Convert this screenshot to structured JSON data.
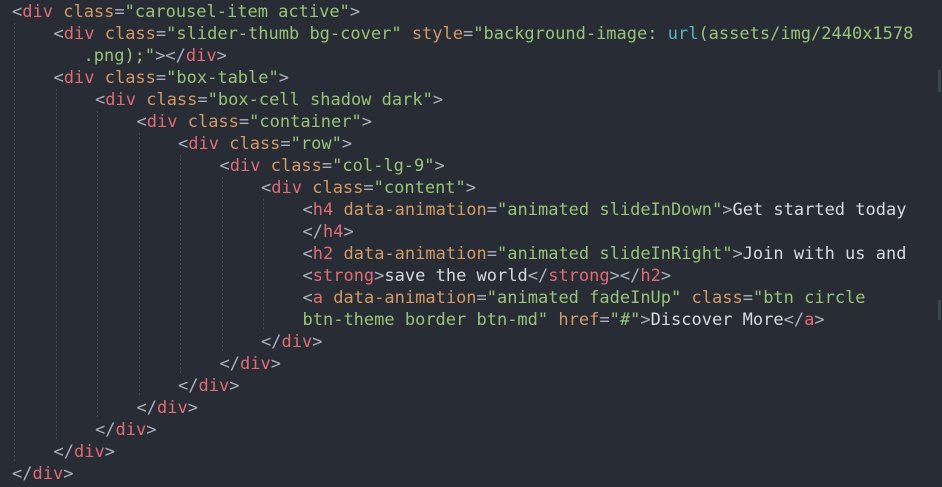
{
  "editor": {
    "language": "html",
    "colors": {
      "background": "#282c34",
      "tag": "#e06c75",
      "attribute": "#d19a66",
      "string": "#98c379",
      "punctuation": "#abb2bf",
      "text": "#d7dae0",
      "url": "#56b6c2",
      "indent_guide": "#4b5263"
    },
    "lines": [
      {
        "indent": 0,
        "tokens": [
          {
            "t": "punc",
            "v": "<"
          },
          {
            "t": "tag",
            "v": "div"
          },
          {
            "t": "def",
            "v": " "
          },
          {
            "t": "attr",
            "v": "class"
          },
          {
            "t": "punc",
            "v": "="
          },
          {
            "t": "str",
            "v": "\"carousel-item active\""
          },
          {
            "t": "punc",
            "v": ">"
          }
        ]
      },
      {
        "indent": 1,
        "tokens": [
          {
            "t": "punc",
            "v": "<"
          },
          {
            "t": "tag",
            "v": "div"
          },
          {
            "t": "def",
            "v": " "
          },
          {
            "t": "attr",
            "v": "class"
          },
          {
            "t": "punc",
            "v": "="
          },
          {
            "t": "str",
            "v": "\"slider-thumb bg-cover\""
          },
          {
            "t": "def",
            "v": " "
          },
          {
            "t": "attr",
            "v": "style"
          },
          {
            "t": "punc",
            "v": "="
          },
          {
            "t": "str",
            "v": "\"background-image: "
          },
          {
            "t": "url",
            "v": "url"
          },
          {
            "t": "str",
            "v": "(assets/img/2440x1578"
          }
        ]
      },
      {
        "indent": 1,
        "wrap": true,
        "tokens": [
          {
            "t": "str",
            "v": ".png);\""
          },
          {
            "t": "punc",
            "v": "></"
          },
          {
            "t": "tag",
            "v": "div"
          },
          {
            "t": "punc",
            "v": ">"
          }
        ]
      },
      {
        "indent": 1,
        "tokens": [
          {
            "t": "punc",
            "v": "<"
          },
          {
            "t": "tag",
            "v": "div"
          },
          {
            "t": "def",
            "v": " "
          },
          {
            "t": "attr",
            "v": "class"
          },
          {
            "t": "punc",
            "v": "="
          },
          {
            "t": "str",
            "v": "\"box-table\""
          },
          {
            "t": "punc",
            "v": ">"
          }
        ]
      },
      {
        "indent": 2,
        "tokens": [
          {
            "t": "punc",
            "v": "<"
          },
          {
            "t": "tag",
            "v": "div"
          },
          {
            "t": "def",
            "v": " "
          },
          {
            "t": "attr",
            "v": "class"
          },
          {
            "t": "punc",
            "v": "="
          },
          {
            "t": "str",
            "v": "\"box-cell shadow dark\""
          },
          {
            "t": "punc",
            "v": ">"
          }
        ]
      },
      {
        "indent": 3,
        "tokens": [
          {
            "t": "punc",
            "v": "<"
          },
          {
            "t": "tag",
            "v": "div"
          },
          {
            "t": "def",
            "v": " "
          },
          {
            "t": "attr",
            "v": "class"
          },
          {
            "t": "punc",
            "v": "="
          },
          {
            "t": "str",
            "v": "\"container\""
          },
          {
            "t": "punc",
            "v": ">"
          }
        ]
      },
      {
        "indent": 4,
        "tokens": [
          {
            "t": "punc",
            "v": "<"
          },
          {
            "t": "tag",
            "v": "div"
          },
          {
            "t": "def",
            "v": " "
          },
          {
            "t": "attr",
            "v": "class"
          },
          {
            "t": "punc",
            "v": "="
          },
          {
            "t": "str",
            "v": "\"row\""
          },
          {
            "t": "punc",
            "v": ">"
          }
        ]
      },
      {
        "indent": 5,
        "tokens": [
          {
            "t": "punc",
            "v": "<"
          },
          {
            "t": "tag",
            "v": "div"
          },
          {
            "t": "def",
            "v": " "
          },
          {
            "t": "attr",
            "v": "class"
          },
          {
            "t": "punc",
            "v": "="
          },
          {
            "t": "str",
            "v": "\"col-lg-9\""
          },
          {
            "t": "punc",
            "v": ">"
          }
        ]
      },
      {
        "indent": 6,
        "tokens": [
          {
            "t": "punc",
            "v": "<"
          },
          {
            "t": "tag",
            "v": "div"
          },
          {
            "t": "def",
            "v": " "
          },
          {
            "t": "attr",
            "v": "class"
          },
          {
            "t": "punc",
            "v": "="
          },
          {
            "t": "str",
            "v": "\"content\""
          },
          {
            "t": "punc",
            "v": ">"
          }
        ]
      },
      {
        "indent": 7,
        "tokens": [
          {
            "t": "punc",
            "v": "<"
          },
          {
            "t": "tag",
            "v": "h4"
          },
          {
            "t": "def",
            "v": " "
          },
          {
            "t": "attr",
            "v": "data-animation"
          },
          {
            "t": "punc",
            "v": "="
          },
          {
            "t": "str",
            "v": "\"animated slideInDown\""
          },
          {
            "t": "punc",
            "v": ">"
          },
          {
            "t": "text",
            "v": "Get started today"
          }
        ]
      },
      {
        "indent": 7,
        "wrap": true,
        "tokens": [
          {
            "t": "punc",
            "v": "</"
          },
          {
            "t": "tag",
            "v": "h4"
          },
          {
            "t": "punc",
            "v": ">"
          }
        ]
      },
      {
        "indent": 7,
        "tokens": [
          {
            "t": "punc",
            "v": "<"
          },
          {
            "t": "tag",
            "v": "h2"
          },
          {
            "t": "def",
            "v": " "
          },
          {
            "t": "attr",
            "v": "data-animation"
          },
          {
            "t": "punc",
            "v": "="
          },
          {
            "t": "str",
            "v": "\"animated slideInRight\""
          },
          {
            "t": "punc",
            "v": ">"
          },
          {
            "t": "text",
            "v": "Join with us and"
          }
        ]
      },
      {
        "indent": 7,
        "wrap": true,
        "tokens": [
          {
            "t": "punc",
            "v": "<"
          },
          {
            "t": "tag",
            "v": "strong"
          },
          {
            "t": "punc",
            "v": ">"
          },
          {
            "t": "text",
            "v": "save the world"
          },
          {
            "t": "punc",
            "v": "</"
          },
          {
            "t": "tag",
            "v": "strong"
          },
          {
            "t": "punc",
            "v": "></"
          },
          {
            "t": "tag",
            "v": "h2"
          },
          {
            "t": "punc",
            "v": ">"
          }
        ]
      },
      {
        "indent": 7,
        "tokens": [
          {
            "t": "punc",
            "v": "<"
          },
          {
            "t": "tag",
            "v": "a"
          },
          {
            "t": "def",
            "v": " "
          },
          {
            "t": "attr",
            "v": "data-animation"
          },
          {
            "t": "punc",
            "v": "="
          },
          {
            "t": "str",
            "v": "\"animated fadeInUp\""
          },
          {
            "t": "def",
            "v": " "
          },
          {
            "t": "attr",
            "v": "class"
          },
          {
            "t": "punc",
            "v": "="
          },
          {
            "t": "str",
            "v": "\"btn circle"
          }
        ]
      },
      {
        "indent": 7,
        "wrap": true,
        "tokens": [
          {
            "t": "str",
            "v": "btn-theme border btn-md\""
          },
          {
            "t": "def",
            "v": " "
          },
          {
            "t": "attr",
            "v": "href"
          },
          {
            "t": "punc",
            "v": "="
          },
          {
            "t": "str",
            "v": "\"#\""
          },
          {
            "t": "punc",
            "v": ">"
          },
          {
            "t": "text",
            "v": "Discover More"
          },
          {
            "t": "punc",
            "v": "</"
          },
          {
            "t": "tag",
            "v": "a"
          },
          {
            "t": "punc",
            "v": ">"
          }
        ]
      },
      {
        "indent": 6,
        "tokens": [
          {
            "t": "punc",
            "v": "</"
          },
          {
            "t": "tag",
            "v": "div"
          },
          {
            "t": "punc",
            "v": ">"
          }
        ]
      },
      {
        "indent": 5,
        "tokens": [
          {
            "t": "punc",
            "v": "</"
          },
          {
            "t": "tag",
            "v": "div"
          },
          {
            "t": "punc",
            "v": ">"
          }
        ]
      },
      {
        "indent": 4,
        "tokens": [
          {
            "t": "punc",
            "v": "</"
          },
          {
            "t": "tag",
            "v": "div"
          },
          {
            "t": "punc",
            "v": ">"
          }
        ]
      },
      {
        "indent": 3,
        "tokens": [
          {
            "t": "punc",
            "v": "</"
          },
          {
            "t": "tag",
            "v": "div"
          },
          {
            "t": "punc",
            "v": ">"
          }
        ]
      },
      {
        "indent": 2,
        "tokens": [
          {
            "t": "punc",
            "v": "</"
          },
          {
            "t": "tag",
            "v": "div"
          },
          {
            "t": "punc",
            "v": ">"
          }
        ]
      },
      {
        "indent": 1,
        "tokens": [
          {
            "t": "punc",
            "v": "</"
          },
          {
            "t": "tag",
            "v": "div"
          },
          {
            "t": "punc",
            "v": ">"
          }
        ]
      },
      {
        "indent": 0,
        "tokens": [
          {
            "t": "punc",
            "v": "</"
          },
          {
            "t": "tag",
            "v": "div"
          },
          {
            "t": "punc",
            "v": ">"
          }
        ]
      }
    ]
  }
}
